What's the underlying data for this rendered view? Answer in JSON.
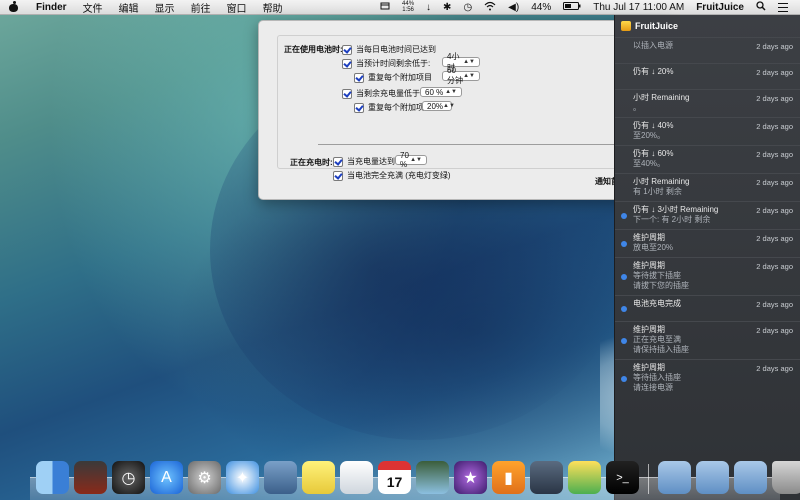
{
  "menubar": {
    "app": "Finder",
    "items": [
      "文件",
      "编辑",
      "显示",
      "前往",
      "窗口",
      "帮助"
    ],
    "fruitjuice_status": {
      "top": "44%",
      "bottom": "1:56"
    },
    "battery_percent": "44%",
    "clock": "Thu Jul 17  11:00 AM",
    "app_title": "FruitJuice"
  },
  "prefs": {
    "on_battery_label": "正在使用电池时:",
    "daily_time": "当每日电池时间已达到",
    "time_low": "当预计时间剩余低于:",
    "time_low_value": "4小时",
    "repeat_each": "重复每个附加项目",
    "repeat_time_value": "60分钟",
    "charge_low": "当剩余充电量低于:",
    "charge_low_value": "60 %",
    "repeat_each2": "重复每个附加项目",
    "repeat_charge_value": "20%",
    "charging_label": "正在充电时:",
    "charge_reached": "当充电量达到:",
    "charge_reached_value": "70 %",
    "fully_charged": "当电池完全充满 (充电灯变绿)",
    "notification_prefs": "通知首选项"
  },
  "nc": {
    "header": "FruitJuice",
    "items": [
      {
        "title": "",
        "sub": "以插入电源",
        "when": "2 days ago",
        "dot": false
      },
      {
        "title": "仍有 ↓ 20%",
        "sub": "",
        "when": "2 days ago",
        "dot": false
      },
      {
        "title": "小时 Remaining",
        "sub": "。",
        "when": "2 days ago",
        "dot": false
      },
      {
        "title": "仍有 ↓ 40%",
        "sub": "至20%。",
        "when": "2 days ago",
        "dot": false
      },
      {
        "title": "仍有 ↓ 60%",
        "sub": "至40%。",
        "when": "2 days ago",
        "dot": false
      },
      {
        "title": "小时 Remaining",
        "sub": "有 1小时 剩余",
        "when": "2 days ago",
        "dot": false
      },
      {
        "title": "仍有 ↓ 3小时 Remaining",
        "sub": "下一个: 有 2小时 剩余",
        "when": "2 days ago",
        "dot": true
      },
      {
        "title": "维护周期",
        "sub": "放电至20%",
        "when": "2 days ago",
        "dot": true
      },
      {
        "title": "维护周期",
        "sub": "等待拔下插座\n请拔下您的插座",
        "when": "2 days ago",
        "dot": true
      },
      {
        "title": "电池充电完成",
        "sub": "",
        "when": "2 days ago",
        "dot": true
      },
      {
        "title": "维护周期",
        "sub": "正在充电至满\n请保持插入插座",
        "when": "2 days ago",
        "dot": true
      },
      {
        "title": "维护周期",
        "sub": "等待插入插座\n请连接电源",
        "when": "2 days ago",
        "dot": true
      }
    ]
  },
  "dock": {
    "apps": [
      "finder-icon",
      "photo-booth-icon",
      "dashboard-icon",
      "app-store-icon",
      "system-preferences-icon",
      "safari-icon",
      "preview-icon",
      "stickies-icon",
      "textedit-icon",
      "calendar-icon",
      "iphoto-icon",
      "imovie-icon",
      "ibooks-icon",
      "image-capture-icon",
      "fruitjuice-icon",
      "terminal-icon"
    ],
    "calendar_day": "17",
    "folders": [
      "applications-folder-icon",
      "downloads-folder-icon",
      "documents-folder-icon",
      "trash-icon"
    ]
  }
}
